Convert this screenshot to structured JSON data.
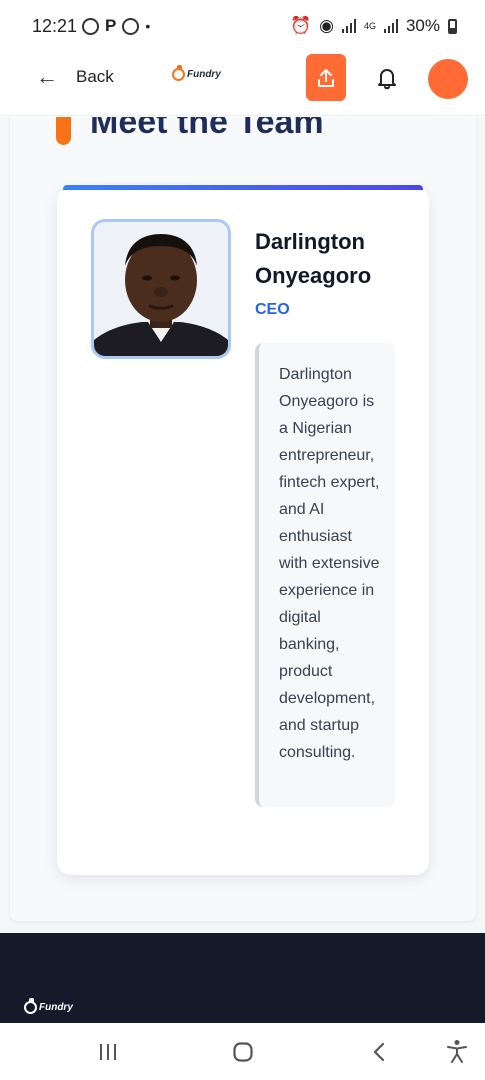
{
  "status_bar": {
    "time": "12:21",
    "notification_p": "P",
    "battery": "30%",
    "network": "4G"
  },
  "header": {
    "back_label": "Back",
    "logo_text": "Fundry",
    "accent_color": "#ff6b35"
  },
  "section": {
    "title": "Meet the Team"
  },
  "member": {
    "name": "Darlington Onyeagoro",
    "role": "CEO",
    "bio": "Darlington Onyeagoro is a Nigerian entrepreneur, fintech expert, and AI enthusiast with extensive experience in digital banking, product development, and startup consulting."
  },
  "footer": {
    "logo_text": "Fundry"
  },
  "icons": {
    "back": "arrow-left-icon",
    "share": "upload-icon",
    "bell": "bell-icon",
    "recent": "recent-apps-icon",
    "home": "home-icon",
    "nav_back": "chevron-left-icon",
    "accessibility": "accessibility-icon"
  }
}
